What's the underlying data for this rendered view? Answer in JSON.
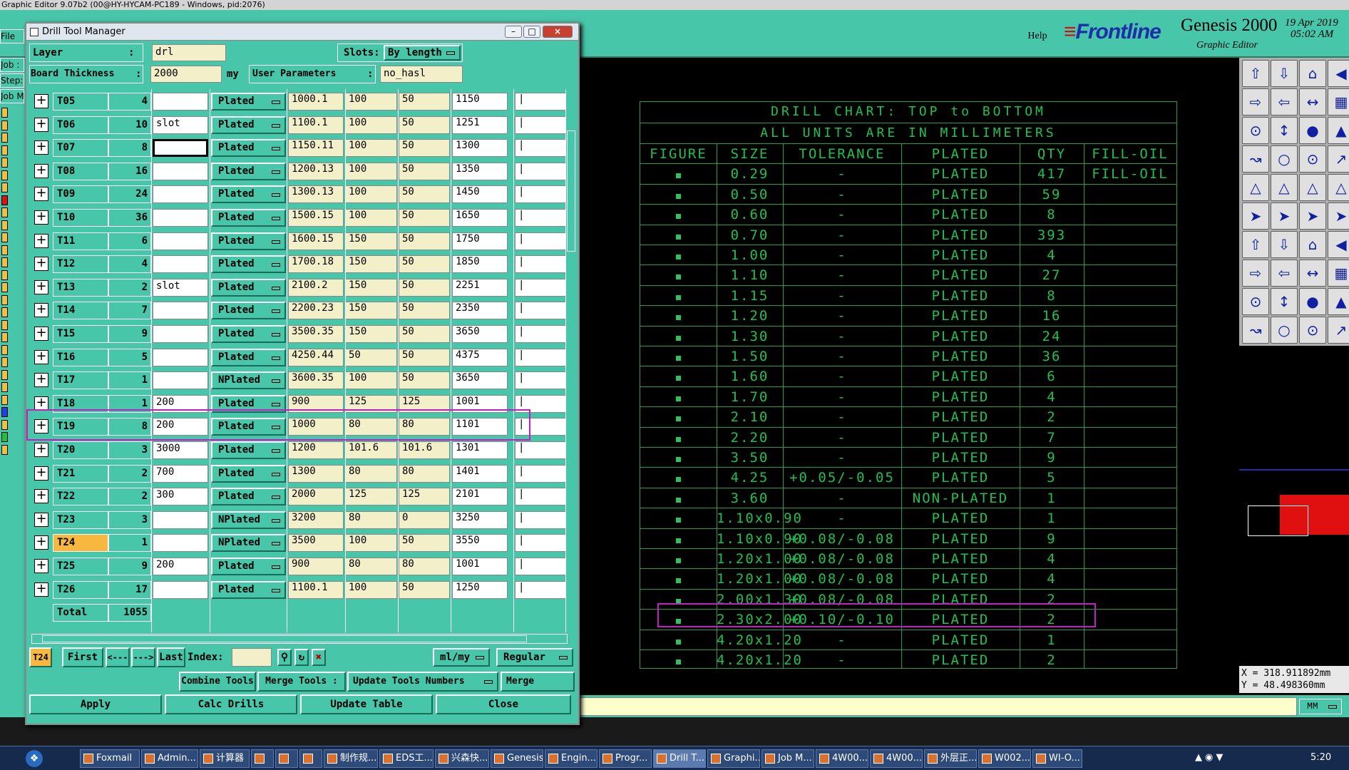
{
  "app_title": "Graphic Editor 9.07b2 (00@HY-HYCAM-PC189 - Windows, pid:2076)",
  "menu": {
    "help": "Help"
  },
  "logo": {
    "frontline": "Frontline",
    "genesis": "Genesis 2000",
    "subtitle": "Graphic Editor",
    "date": "19 Apr 2019",
    "time": "05:02 AM"
  },
  "left_strip": {
    "file": "File",
    "job": "Job :",
    "step": "Step:",
    "col": "Job M"
  },
  "dialog": {
    "title": "Drill Tool Manager",
    "layer_label": "Layer",
    "layer_sep": ":",
    "layer_value": "drl",
    "slots_label": "Slots:",
    "slots_value": "By length",
    "thickness_label": "Board Thickness",
    "thickness_sep": ":",
    "thickness_value": "2000",
    "thickness_unit": "my",
    "user_params_label": "User Parameters",
    "user_params_sep": ":",
    "user_params_value": "no_hasl",
    "rows": [
      {
        "tool": "T05",
        "count": "4",
        "slot": "",
        "type": "Plated",
        "finish": "1000.1",
        "tol_plus": "100",
        "tol_minus": "50",
        "drill": "1150"
      },
      {
        "tool": "T06",
        "count": "10",
        "slot": "slot",
        "type": "Plated",
        "finish": "1100.1",
        "tol_plus": "100",
        "tol_minus": "50",
        "drill": "1251"
      },
      {
        "tool": "T07",
        "count": "8",
        "slot": "",
        "type": "Plated",
        "finish": "1150.11",
        "tol_plus": "100",
        "tol_minus": "50",
        "drill": "1300"
      },
      {
        "tool": "T08",
        "count": "16",
        "slot": "",
        "type": "Plated",
        "finish": "1200.13",
        "tol_plus": "100",
        "tol_minus": "50",
        "drill": "1350"
      },
      {
        "tool": "T09",
        "count": "24",
        "slot": "",
        "type": "Plated",
        "finish": "1300.13",
        "tol_plus": "100",
        "tol_minus": "50",
        "drill": "1450"
      },
      {
        "tool": "T10",
        "count": "36",
        "slot": "",
        "type": "Plated",
        "finish": "1500.15",
        "tol_plus": "100",
        "tol_minus": "50",
        "drill": "1650"
      },
      {
        "tool": "T11",
        "count": "6",
        "slot": "",
        "type": "Plated",
        "finish": "1600.15",
        "tol_plus": "150",
        "tol_minus": "50",
        "drill": "1750"
      },
      {
        "tool": "T12",
        "count": "4",
        "slot": "",
        "type": "Plated",
        "finish": "1700.18",
        "tol_plus": "150",
        "tol_minus": "50",
        "drill": "1850"
      },
      {
        "tool": "T13",
        "count": "2",
        "slot": "slot",
        "type": "Plated",
        "finish": "2100.2",
        "tol_plus": "150",
        "tol_minus": "50",
        "drill": "2251"
      },
      {
        "tool": "T14",
        "count": "7",
        "slot": "",
        "type": "Plated",
        "finish": "2200.23",
        "tol_plus": "150",
        "tol_minus": "50",
        "drill": "2350"
      },
      {
        "tool": "T15",
        "count": "9",
        "slot": "",
        "type": "Plated",
        "finish": "3500.35",
        "tol_plus": "150",
        "tol_minus": "50",
        "drill": "3650"
      },
      {
        "tool": "T16",
        "count": "5",
        "slot": "",
        "type": "Plated",
        "finish": "4250.44",
        "tol_plus": "50",
        "tol_minus": "50",
        "drill": "4375"
      },
      {
        "tool": "T17",
        "count": "1",
        "slot": "",
        "type": "NPlated",
        "finish": "3600.35",
        "tol_plus": "100",
        "tol_minus": "50",
        "drill": "3650"
      },
      {
        "tool": "T18",
        "count": "1",
        "slot": "200",
        "type": "Plated",
        "finish": "900",
        "tol_plus": "125",
        "tol_minus": "125",
        "drill": "1001"
      },
      {
        "tool": "T19",
        "count": "8",
        "slot": "200",
        "type": "Plated",
        "finish": "1000",
        "tol_plus": "80",
        "tol_minus": "80",
        "drill": "1101"
      },
      {
        "tool": "T20",
        "count": "3",
        "slot": "3000",
        "type": "Plated",
        "finish": "1200",
        "tol_plus": "101.6",
        "tol_minus": "101.6",
        "drill": "1301"
      },
      {
        "tool": "T21",
        "count": "2",
        "slot": "700",
        "type": "Plated",
        "finish": "1300",
        "tol_plus": "80",
        "tol_minus": "80",
        "drill": "1401"
      },
      {
        "tool": "T22",
        "count": "2",
        "slot": "300",
        "type": "Plated",
        "finish": "2000",
        "tol_plus": "125",
        "tol_minus": "125",
        "drill": "2101"
      },
      {
        "tool": "T23",
        "count": "3",
        "slot": "",
        "type": "NPlated",
        "finish": "3200",
        "tol_plus": "80",
        "tol_minus": "0",
        "drill": "3250"
      },
      {
        "tool": "T24",
        "count": "1",
        "slot": "",
        "type": "NPlated",
        "finish": "3500",
        "tol_plus": "100",
        "tol_minus": "50",
        "drill": "3550"
      },
      {
        "tool": "T25",
        "count": "9",
        "slot": "200",
        "type": "Plated",
        "finish": "900",
        "tol_plus": "80",
        "tol_minus": "80",
        "drill": "1001"
      },
      {
        "tool": "T26",
        "count": "17",
        "slot": "",
        "type": "Plated",
        "finish": "1100.1",
        "tol_plus": "100",
        "tol_minus": "50",
        "drill": "1250"
      }
    ],
    "total_label": "Total",
    "total_value": "1055",
    "current_tool": "T24",
    "nav": {
      "first": "First",
      "prev": "<---",
      "next": "--->",
      "last": "Last",
      "index_label": "Index:"
    },
    "units": "ml/my",
    "mode": "Regular",
    "buttons": {
      "combine": "Combine Tools",
      "merge_tools": "Merge Tools :",
      "update_numbers": "Update Tools Numbers",
      "merge": "Merge",
      "apply": "Apply",
      "calc": "Calc Drills",
      "update_table": "Update Table",
      "close": "Close"
    }
  },
  "chart": {
    "title": "DRILL CHART: TOP to BOTTOM",
    "units": "ALL UNITS ARE IN MILLIMETERS",
    "headers": [
      "FIGURE",
      "SIZE",
      "TOLERANCE",
      "PLATED",
      "QTY",
      "FILL-OIL"
    ],
    "rows": [
      {
        "size": "0.29",
        "tol": "-",
        "plated": "PLATED",
        "qty": "417",
        "fill": "FILL-OIL"
      },
      {
        "size": "0.50",
        "tol": "-",
        "plated": "PLATED",
        "qty": "59",
        "fill": ""
      },
      {
        "size": "0.60",
        "tol": "-",
        "plated": "PLATED",
        "qty": "8",
        "fill": ""
      },
      {
        "size": "0.70",
        "tol": "-",
        "plated": "PLATED",
        "qty": "393",
        "fill": ""
      },
      {
        "size": "1.00",
        "tol": "-",
        "plated": "PLATED",
        "qty": "4",
        "fill": ""
      },
      {
        "size": "1.10",
        "tol": "-",
        "plated": "PLATED",
        "qty": "27",
        "fill": ""
      },
      {
        "size": "1.15",
        "tol": "-",
        "plated": "PLATED",
        "qty": "8",
        "fill": ""
      },
      {
        "size": "1.20",
        "tol": "-",
        "plated": "PLATED",
        "qty": "16",
        "fill": ""
      },
      {
        "size": "1.30",
        "tol": "-",
        "plated": "PLATED",
        "qty": "24",
        "fill": ""
      },
      {
        "size": "1.50",
        "tol": "-",
        "plated": "PLATED",
        "qty": "36",
        "fill": ""
      },
      {
        "size": "1.60",
        "tol": "-",
        "plated": "PLATED",
        "qty": "6",
        "fill": ""
      },
      {
        "size": "1.70",
        "tol": "-",
        "plated": "PLATED",
        "qty": "4",
        "fill": ""
      },
      {
        "size": "2.10",
        "tol": "-",
        "plated": "PLATED",
        "qty": "2",
        "fill": ""
      },
      {
        "size": "2.20",
        "tol": "-",
        "plated": "PLATED",
        "qty": "7",
        "fill": ""
      },
      {
        "size": "3.50",
        "tol": "-",
        "plated": "PLATED",
        "qty": "9",
        "fill": ""
      },
      {
        "size": "4.25",
        "tol": "+0.05/-0.05",
        "plated": "PLATED",
        "qty": "5",
        "fill": ""
      },
      {
        "size": "3.60",
        "tol": "-",
        "plated": "NON-PLATED",
        "qty": "1",
        "fill": ""
      },
      {
        "size": "1.10x0.90",
        "tol": "-",
        "plated": "PLATED",
        "qty": "1",
        "fill": ""
      },
      {
        "size": "1.10x0.90",
        "tol": "+0.08/-0.08",
        "plated": "PLATED",
        "qty": "9",
        "fill": ""
      },
      {
        "size": "1.20x1.00",
        "tol": "+0.08/-0.08",
        "plated": "PLATED",
        "qty": "4",
        "fill": ""
      },
      {
        "size": "1.20x1.00",
        "tol": "+0.08/-0.08",
        "plated": "PLATED",
        "qty": "4",
        "fill": ""
      },
      {
        "size": "2.00x1.30",
        "tol": "+0.08/-0.08",
        "plated": "PLATED",
        "qty": "2",
        "fill": ""
      },
      {
        "size": "2.30x2.00",
        "tol": "+0.10/-0.10",
        "plated": "PLATED",
        "qty": "2",
        "fill": ""
      },
      {
        "size": "4.20x1.20",
        "tol": "-",
        "plated": "PLATED",
        "qty": "1",
        "fill": ""
      },
      {
        "size": "4.20x1.20",
        "tol": "-",
        "plated": "PLATED",
        "qty": "2",
        "fill": ""
      }
    ]
  },
  "coords": {
    "x": "X = 318.911892mm",
    "y": "Y = 48.498360mm"
  },
  "units_btn": "MM",
  "taskbar": {
    "items": [
      "Foxmail",
      "Admin...",
      "计算器",
      "",
      "",
      "",
      "制作规...",
      "EDS工...",
      "兴森快...",
      "Genesis",
      "Engin...",
      "Progr...",
      "Drill T...",
      "Graphi...",
      "Job M...",
      "4W00...",
      "4W00...",
      "外层正...",
      "W002...",
      "WI-O..."
    ],
    "clock": "5:20"
  },
  "colors": {
    "panel": "#48c6aa",
    "chart_line": "#20c050",
    "highlight": "#c020c0",
    "selected_tool": "#f8b840"
  }
}
